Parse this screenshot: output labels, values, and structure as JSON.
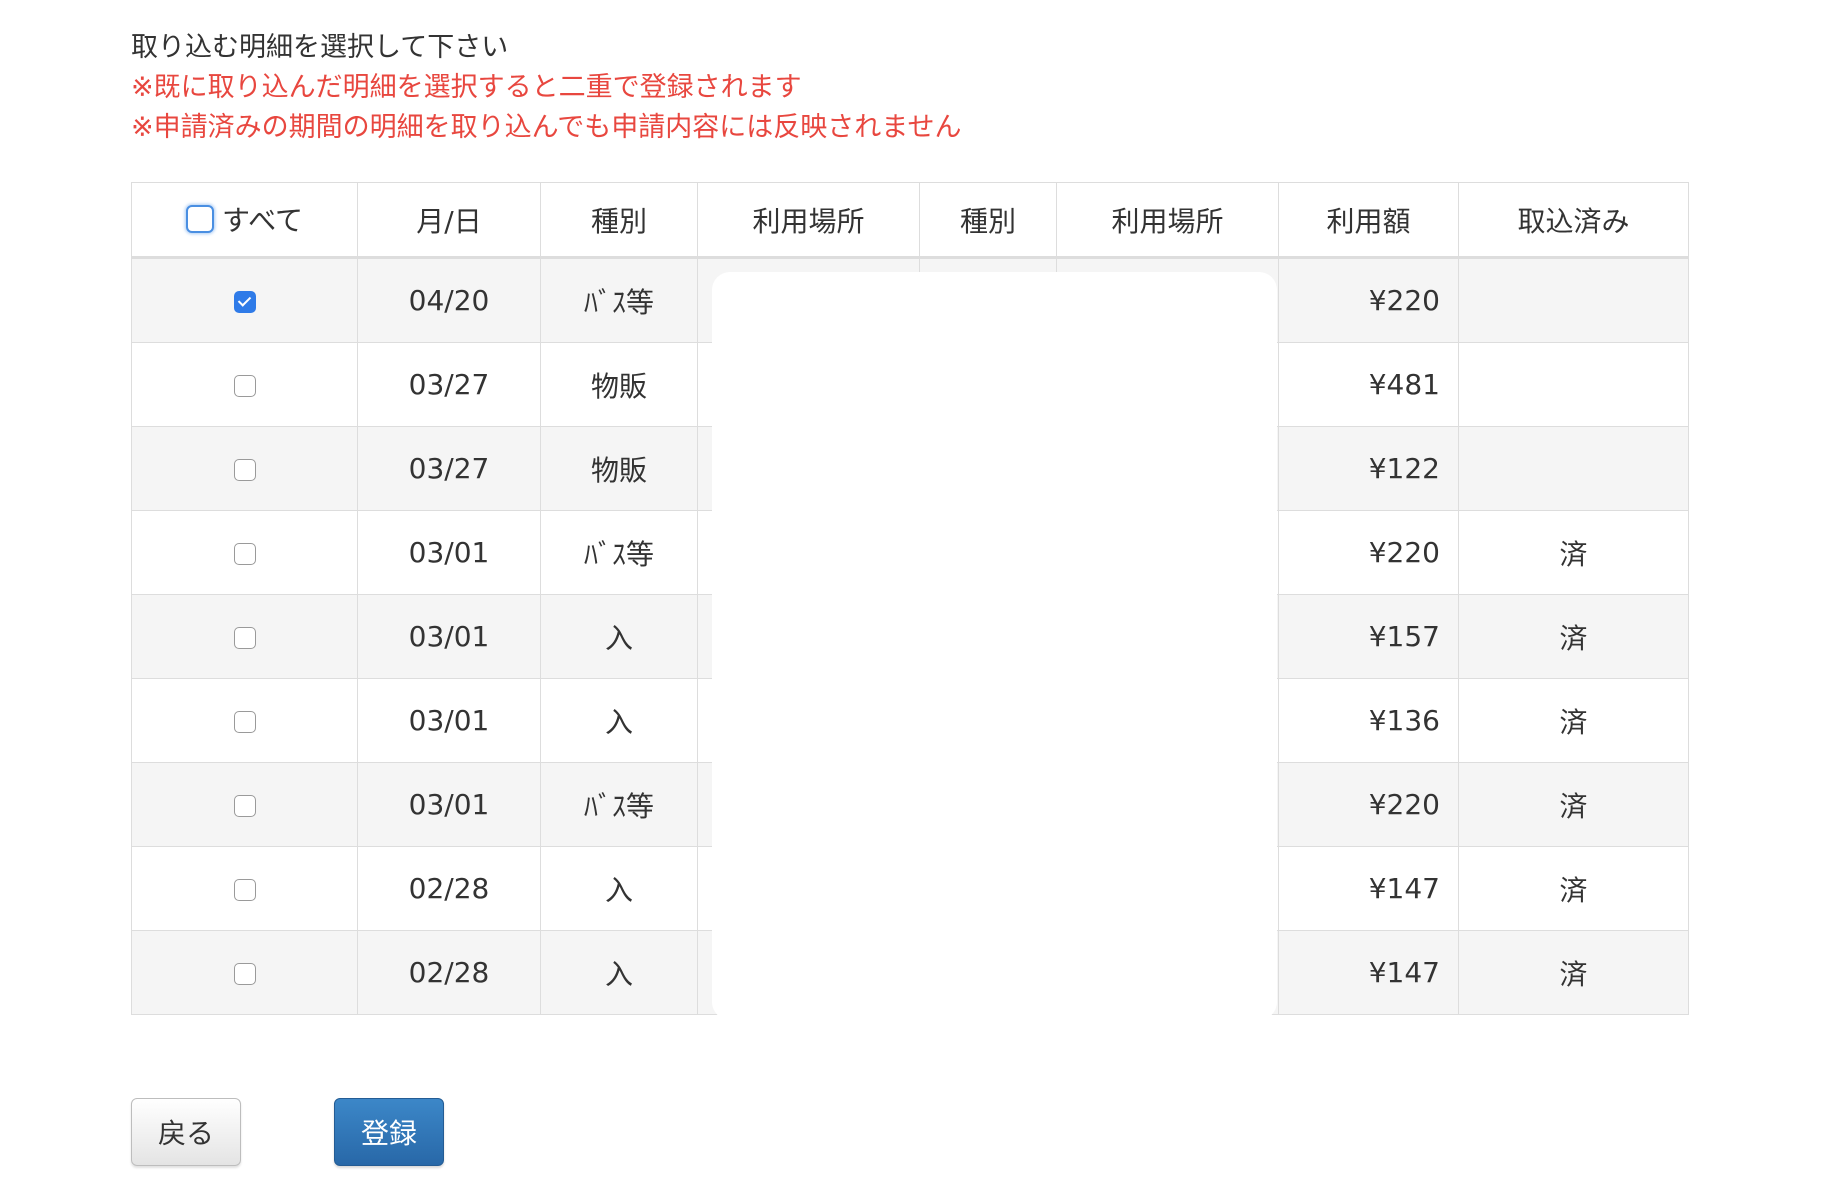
{
  "intro": {
    "instruction": "取り込む明細を選択して下さい",
    "warning_1": "※既に取り込んだ明細を選択すると二重で登録されます",
    "warning_2": "※申請済みの期間の明細を取り込んでも申請内容には反映されません"
  },
  "colors": {
    "warning": "#e8473f",
    "checkbox_checked": "#2f7be8",
    "primary_button": "#2f76b8",
    "row_stripe": "#f5f5f5"
  },
  "table": {
    "select_all_label": "すべて",
    "select_all_checked": false,
    "headers": {
      "date": "月/日",
      "category_1": "種別",
      "place_1": "利用場所",
      "category_2": "種別",
      "place_2": "利用場所",
      "amount": "利用額",
      "imported": "取込済み"
    },
    "rows": [
      {
        "checked": true,
        "date": "04/20",
        "category": "ﾊﾞｽ等",
        "amount": "¥220",
        "imported": ""
      },
      {
        "checked": false,
        "date": "03/27",
        "category": "物販",
        "amount": "¥481",
        "imported": ""
      },
      {
        "checked": false,
        "date": "03/27",
        "category": "物販",
        "amount": "¥122",
        "imported": ""
      },
      {
        "checked": false,
        "date": "03/01",
        "category": "ﾊﾞｽ等",
        "amount": "¥220",
        "imported": "済"
      },
      {
        "checked": false,
        "date": "03/01",
        "category": "入",
        "amount": "¥157",
        "imported": "済"
      },
      {
        "checked": false,
        "date": "03/01",
        "category": "入",
        "amount": "¥136",
        "imported": "済"
      },
      {
        "checked": false,
        "date": "03/01",
        "category": "ﾊﾞｽ等",
        "amount": "¥220",
        "imported": "済"
      },
      {
        "checked": false,
        "date": "02/28",
        "category": "入",
        "amount": "¥147",
        "imported": "済"
      },
      {
        "checked": false,
        "date": "02/28",
        "category": "入",
        "amount": "¥147",
        "imported": "済"
      }
    ]
  },
  "buttons": {
    "back": "戻る",
    "submit": "登録"
  }
}
